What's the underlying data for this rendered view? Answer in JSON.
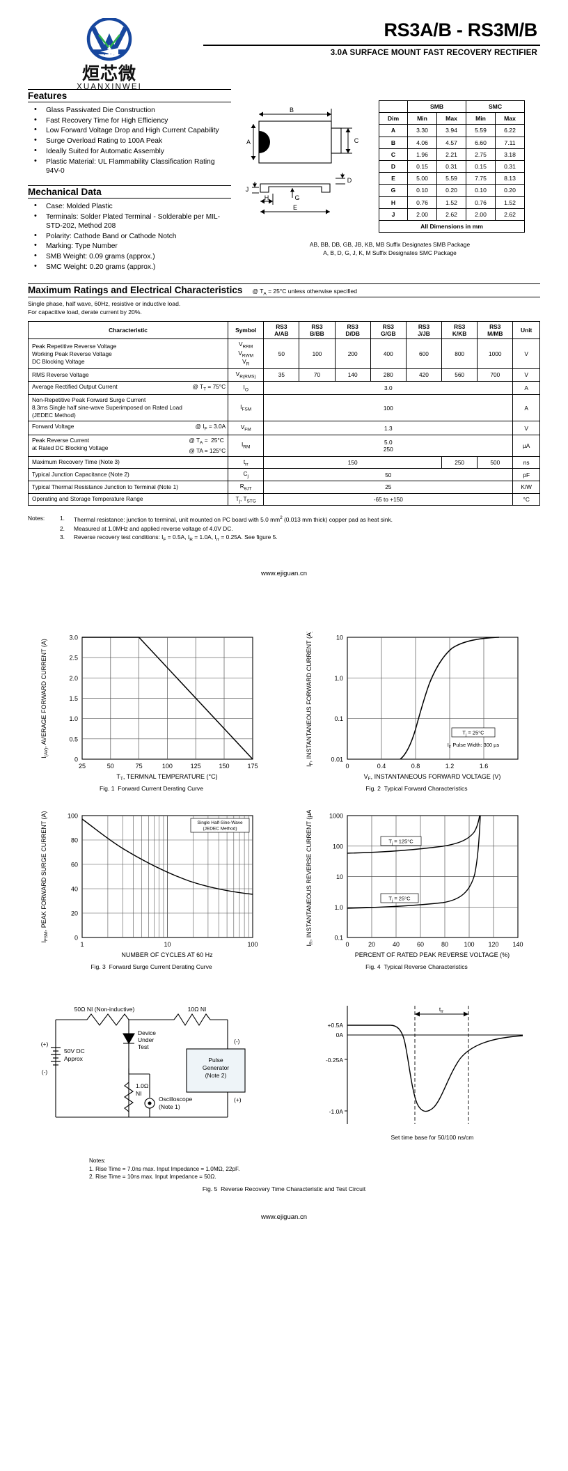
{
  "header": {
    "part_title": "RS3A/B - RS3M/B",
    "subtitle": "3.0A SURFACE MOUNT FAST RECOVERY RECTIFIER",
    "logo_cn": "烜芯微",
    "logo_en": "XUANXINWEI",
    "logo_mark": "XW"
  },
  "features": {
    "heading": "Features",
    "items": [
      "Glass Passivated Die Construction",
      "Fast Recovery Time for High Efficiency",
      "Low Forward Voltage Drop and High Current Capability",
      "Surge Overload Rating to 100A Peak",
      "Ideally Suited for Automatic Assembly",
      "Plastic Material: UL Flammability Classification Rating 94V-0"
    ]
  },
  "mechanical": {
    "heading": "Mechanical Data",
    "items": [
      "Case: Molded Plastic",
      "Terminals: Solder Plated Terminal - Solderable per MIL-STD-202, Method 208",
      "Polarity: Cathode Band or Cathode Notch",
      "Marking: Type Number",
      "SMB Weight: 0.09 grams (approx.)",
      "SMC Weight: 0.20 grams (approx.)"
    ]
  },
  "package": {
    "labels": {
      "A": "A",
      "B": "B",
      "C": "C",
      "D": "D",
      "E": "E",
      "G": "G",
      "H": "H",
      "J": "J"
    },
    "dim_table": {
      "group_headers": [
        "SMB",
        "SMC"
      ],
      "columns": [
        "Dim",
        "Min",
        "Max",
        "Min",
        "Max"
      ],
      "rows": [
        [
          "A",
          "3.30",
          "3.94",
          "5.59",
          "6.22"
        ],
        [
          "B",
          "4.06",
          "4.57",
          "6.60",
          "7.11"
        ],
        [
          "C",
          "1.96",
          "2.21",
          "2.75",
          "3.18"
        ],
        [
          "D",
          "0.15",
          "0.31",
          "0.15",
          "0.31"
        ],
        [
          "E",
          "5.00",
          "5.59",
          "7.75",
          "8.13"
        ],
        [
          "G",
          "0.10",
          "0.20",
          "0.10",
          "0.20"
        ],
        [
          "H",
          "0.76",
          "1.52",
          "0.76",
          "1.52"
        ],
        [
          "J",
          "2.00",
          "2.62",
          "2.00",
          "2.62"
        ]
      ],
      "footer": "All Dimensions in mm"
    },
    "suffix_note_1": "AB, BB, DB, GB, JB, KB, MB Suffix Designates SMB Package",
    "suffix_note_2": "A, B, D, G, J, K, M Suffix Designates SMC Package"
  },
  "ratings": {
    "heading": "Maximum Ratings and Electrical Characteristics",
    "heading_note": "@ TA = 25°C unless otherwise specified",
    "preamble_1": "Single phase, half wave, 60Hz, resistive or inductive load.",
    "preamble_2": "For capacitive load, derate current by 20%.",
    "col_characteristic": "Characteristic",
    "col_symbol": "Symbol",
    "col_unit": "Unit",
    "device_columns": [
      "RS3 A/AB",
      "RS3 B/BB",
      "RS3 D/DB",
      "RS3 G/GB",
      "RS3 J/JB",
      "RS3 K/KB",
      "RS3 M/MB"
    ],
    "rows": [
      {
        "characteristic": "Peak Repetitive Reverse Voltage\nWorking Peak Reverse Voltage\nDC Blocking Voltage",
        "symbol": "VRRM VRWM VR",
        "values": [
          "50",
          "100",
          "200",
          "400",
          "600",
          "800",
          "1000"
        ],
        "unit": "V"
      },
      {
        "characteristic": "RMS Reverse Voltage",
        "symbol": "VR(RMS)",
        "values": [
          "35",
          "70",
          "140",
          "280",
          "420",
          "560",
          "700"
        ],
        "unit": "V"
      },
      {
        "characteristic": "Average Rectified Output Current",
        "condition": "@ TT = 75°C",
        "symbol": "IO",
        "span_value": "3.0",
        "unit": "A"
      },
      {
        "characteristic": "Non-Repetitive Peak Forward Surge Current\n8.3ms Single half sine-wave Superimposed on Rated Load\n(JEDEC Method)",
        "symbol": "IFSM",
        "span_value": "100",
        "unit": "A"
      },
      {
        "characteristic": "Forward Voltage",
        "condition": "@ IF = 3.0A",
        "symbol": "VFM",
        "span_value": "1.3",
        "unit": "V"
      },
      {
        "characteristic": "Peak Reverse Current\nat Rated DC Blocking Voltage",
        "condition": "@ TA =  25°C\n@ TA = 125°C",
        "symbol": "IRM",
        "span_value": "5.0\n250",
        "unit": "µA"
      },
      {
        "characteristic": "Maximum Recovery Time (Note 3)",
        "symbol": "trr",
        "split_values": [
          "150",
          "250",
          "500"
        ],
        "unit": "ns"
      },
      {
        "characteristic": "Typical Junction Capacitance (Note 2)",
        "symbol": "Cj",
        "span_value": "50",
        "unit": "pF"
      },
      {
        "characteristic": "Typical Thermal Resistance Junction to Terminal (Note 1)",
        "symbol": "RθJT",
        "span_value": "25",
        "unit": "K/W"
      },
      {
        "characteristic": "Operating and Storage Temperature Range",
        "symbol": "Tj, TSTG",
        "span_value": "-65 to +150",
        "unit": "°C"
      }
    ],
    "notes_label": "Notes:",
    "notes": [
      "Thermal resistance: junction to terminal, unit mounted on PC board with 5.0 mm2 (0.013 mm thick) copper pad as heat sink.",
      "Measured at 1.0MHz and applied reverse voltage of 4.0V DC.",
      "Reverse recovery test conditions: IF = 0.5A, IR = 1.0A, Irr = 0.25A. See figure 5."
    ],
    "url": "www.ejiguan.cn"
  },
  "chart_data": [
    {
      "type": "line",
      "fig": "Fig. 1",
      "title": "Forward Current Derating Curve",
      "xlabel": "TT, TERMINAL TEMPERATURE (°C)",
      "ylabel": "I(AV), AVERAGE FORWARD CURRENT (A)",
      "xticks": [
        "25",
        "50",
        "75",
        "100",
        "125",
        "150",
        "175"
      ],
      "yticks": [
        "0",
        "0.5",
        "1.0",
        "1.5",
        "2.0",
        "2.5",
        "3.0"
      ],
      "xlim": [
        25,
        175
      ],
      "ylim": [
        0,
        3.0
      ],
      "grid": true,
      "x": [
        25,
        75,
        175
      ],
      "values": [
        3.0,
        3.0,
        0
      ]
    },
    {
      "type": "line",
      "fig": "Fig. 2",
      "title": "Typical Forward Characteristics",
      "xlabel": "VF, INSTANTANEOUS FORWARD VOLTAGE (V)",
      "ylabel": "IF, INSTANTANEOUS FORWARD CURRENT (A)",
      "xticks": [
        "0",
        "0.4",
        "0.8",
        "1.2",
        "1.6"
      ],
      "yticks": [
        "0.01",
        "0.1",
        "1.0",
        "10"
      ],
      "xlim": [
        0,
        2.0
      ],
      "ylim": [
        0.01,
        10
      ],
      "yscale": "log",
      "grid": true,
      "annotations": [
        "Tj = 25°C",
        "IF Pulse Width: 300 µs"
      ],
      "x": [
        0.62,
        0.72,
        0.82,
        0.92,
        1.02,
        1.14,
        1.3,
        1.5
      ],
      "values": [
        0.01,
        0.03,
        0.1,
        0.3,
        1.0,
        2.5,
        6.0,
        10
      ]
    },
    {
      "type": "line",
      "fig": "Fig. 3",
      "title": "Forward Surge Current Derating Curve",
      "xlabel": "NUMBER OF CYCLES AT 60 Hz",
      "ylabel": "IFSM, PEAK FORWARD SURGE CURRENT (A)",
      "xticks": [
        "1",
        "10",
        "100"
      ],
      "yticks": [
        "0",
        "20",
        "40",
        "60",
        "80",
        "100"
      ],
      "xlim": [
        1,
        100
      ],
      "ylim": [
        0,
        100
      ],
      "xscale": "log",
      "grid": true,
      "annotations": [
        "Single Half-Sine-Wave",
        "(JEDEC Method)"
      ],
      "x": [
        1,
        2,
        4,
        10,
        20,
        40,
        100
      ],
      "values": [
        97,
        85,
        73,
        58,
        49,
        43,
        36
      ]
    },
    {
      "type": "line",
      "fig": "Fig. 4",
      "title": "Typical Reverse Characteristics",
      "xlabel": "PERCENT OF RATED PEAK REVERSE VOLTAGE (%)",
      "ylabel": "IR, INSTANTANEOUS REVERSE CURRENT (µA)",
      "xticks": [
        "0",
        "20",
        "40",
        "60",
        "80",
        "100",
        "120",
        "140"
      ],
      "yticks": [
        "0.1",
        "1.0",
        "10",
        "100",
        "1000"
      ],
      "xlim": [
        0,
        140
      ],
      "ylim": [
        0.1,
        1000
      ],
      "yscale": "log",
      "grid": true,
      "series": [
        {
          "name": "Tj = 125°C",
          "x": [
            0,
            20,
            60,
            100,
            115,
            120,
            122
          ],
          "values": [
            60,
            62,
            70,
            95,
            170,
            600,
            1000
          ]
        },
        {
          "name": "Tj = 25°C",
          "x": [
            0,
            20,
            60,
            100,
            115,
            120,
            122
          ],
          "values": [
            0.9,
            0.95,
            1.0,
            1.3,
            3.0,
            60,
            1000
          ]
        }
      ]
    }
  ],
  "circuit": {
    "fig": "Fig. 5",
    "title": "Reverse Recovery Time Characteristic and Test Circuit",
    "labels": {
      "r1": "50Ω NI (Non-inductive)",
      "r2": "10Ω NI",
      "dut": "Device\nUnder\nTest",
      "supply": "50V DC\nApprox",
      "rsense": "1.0Ω\nNI",
      "scope": "Oscilloscope\n(Note 1)",
      "pulsegen": "Pulse\nGenerator\n(Note 2)",
      "plus": "(+)",
      "minus": "(-)"
    },
    "notes_label": "Notes:",
    "notes": [
      "1. Rise Time = 7.0ns max. Input Impedance = 1.0MΩ, 22pF.",
      "2. Rise Time = 10ns max. Input Impedance = 50Ω."
    ],
    "waveform": {
      "yticks": [
        "+0.5A",
        "0A",
        "-0.25A",
        "-1.0A"
      ],
      "trr_label": "trr",
      "timebase": "Set time base for 50/100 ns/cm"
    }
  },
  "footer": {
    "url": "www.ejiguan.cn"
  }
}
